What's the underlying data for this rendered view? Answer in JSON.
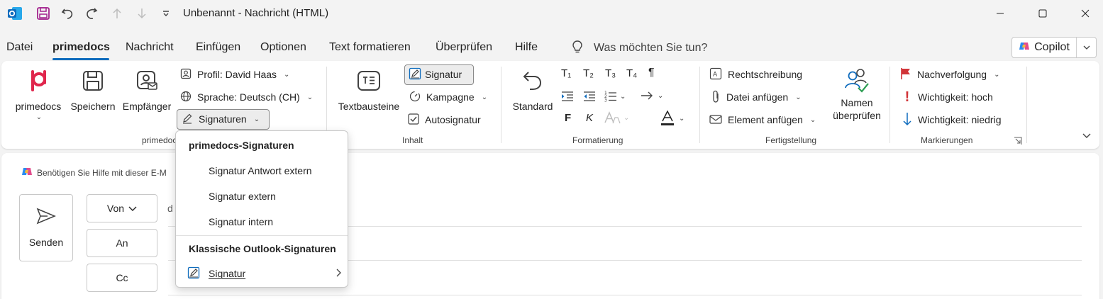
{
  "window": {
    "title": "Unbenannt  -  Nachricht (HTML)"
  },
  "tabs": [
    "Datei",
    "primedocs",
    "Nachricht",
    "Einfügen",
    "Optionen",
    "Text formatieren",
    "Überprüfen",
    "Hilfe"
  ],
  "search": {
    "placeholder": "Was möchten Sie tun?"
  },
  "copilot": {
    "label": "Copilot"
  },
  "ribbon": {
    "primedocs_group": {
      "label": "primedoc",
      "primedocs": "primedocs",
      "speichern": "Speichern",
      "empfaenger": "Empfänger",
      "profil": "Profil: David Haas",
      "sprache": "Sprache: Deutsch (CH)",
      "signaturen": "Signaturen"
    },
    "inhalt_group": {
      "label": "Inhalt",
      "textbausteine": "Textbausteine",
      "signatur": "Signatur",
      "kampagne": "Kampagne",
      "autosignatur": "Autosignatur"
    },
    "formatierung_group": {
      "label": "Formatierung",
      "standard": "Standard",
      "t1": "T₁",
      "t2": "T₂",
      "t3": "T₃",
      "t4": "T₄",
      "pilcrow": "¶",
      "bold": "F",
      "italic": "K"
    },
    "fertigstellung_group": {
      "label": "Fertigstellung",
      "rechtschreibung": "Rechtschreibung",
      "datei_anfuegen": "Datei anfügen",
      "element_anfuegen": "Element anfügen",
      "namen_line1": "Namen",
      "namen_line2": "überprüfen"
    },
    "markierungen_group": {
      "label": "Markierungen",
      "nachverfolgung": "Nachverfolgung",
      "wichtigkeit_hoch": "Wichtigkeit: hoch",
      "wichtigkeit_niedrig": "Wichtigkeit: niedrig"
    }
  },
  "compose": {
    "help_text": "Benötigen Sie Hilfe mit dieser E-M",
    "send": "Senden",
    "von": "Von",
    "an": "An",
    "cc": "Cc",
    "from_value": "d"
  },
  "menu": {
    "section1": "primedocs-Signaturen",
    "items": [
      "Signatur Antwort extern",
      "Signatur extern",
      "Signatur intern"
    ],
    "section2": "Klassische Outlook-Signaturen",
    "classic_item": "Signatur"
  },
  "colors": {
    "accent": "#0f6cbd",
    "primedocs_brand": "#e0274d",
    "flag_red": "#d13438",
    "outlook_blue": "#0f6cbd"
  }
}
